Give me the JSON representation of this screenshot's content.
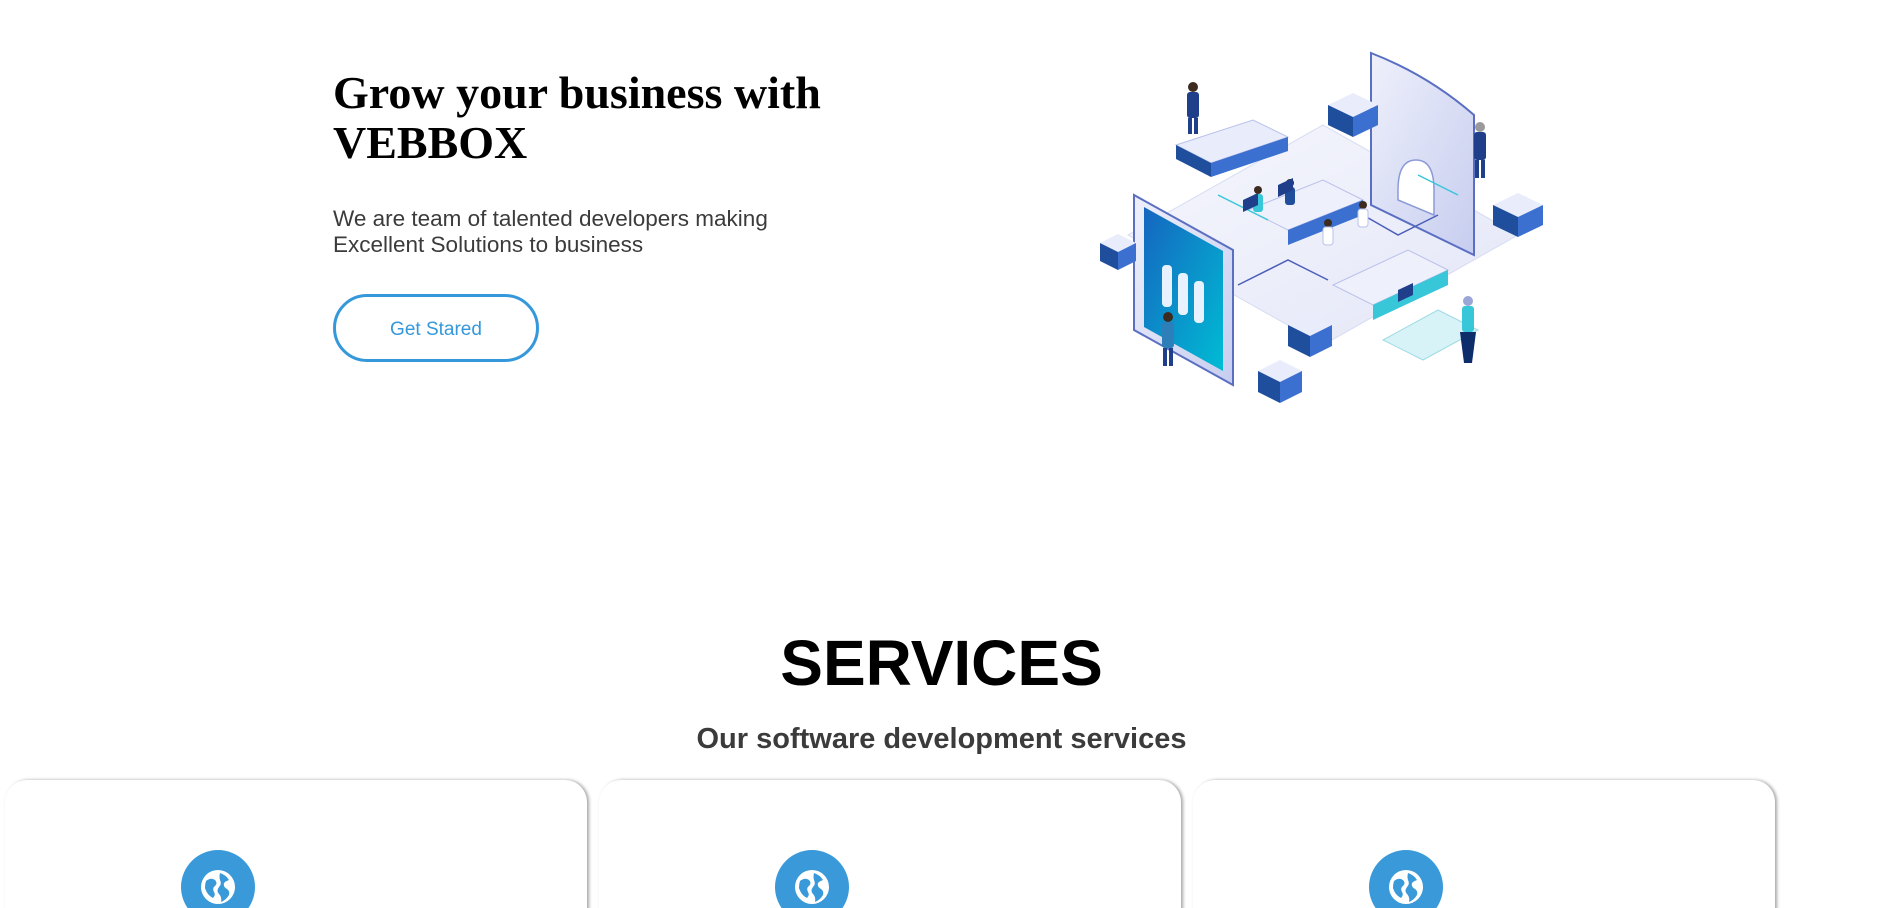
{
  "hero": {
    "title_line1": "Grow your business with",
    "title_line2": "VEBBOX",
    "subtitle_line1": "We are team of talented developers making",
    "subtitle_line2": "Excellent Solutions to business",
    "cta_label": "Get Stared",
    "illustration_icon": "isometric-office-illustration"
  },
  "services": {
    "title": "SERVICES",
    "subtitle": "Our software development services",
    "cards": [
      {
        "icon": "globe-icon"
      },
      {
        "icon": "globe-icon"
      },
      {
        "icon": "globe-icon"
      }
    ]
  },
  "colors": {
    "accent": "#3498db",
    "heading": "#000000",
    "body_text": "#3b3b3b",
    "badge": "#3a9ad9"
  }
}
